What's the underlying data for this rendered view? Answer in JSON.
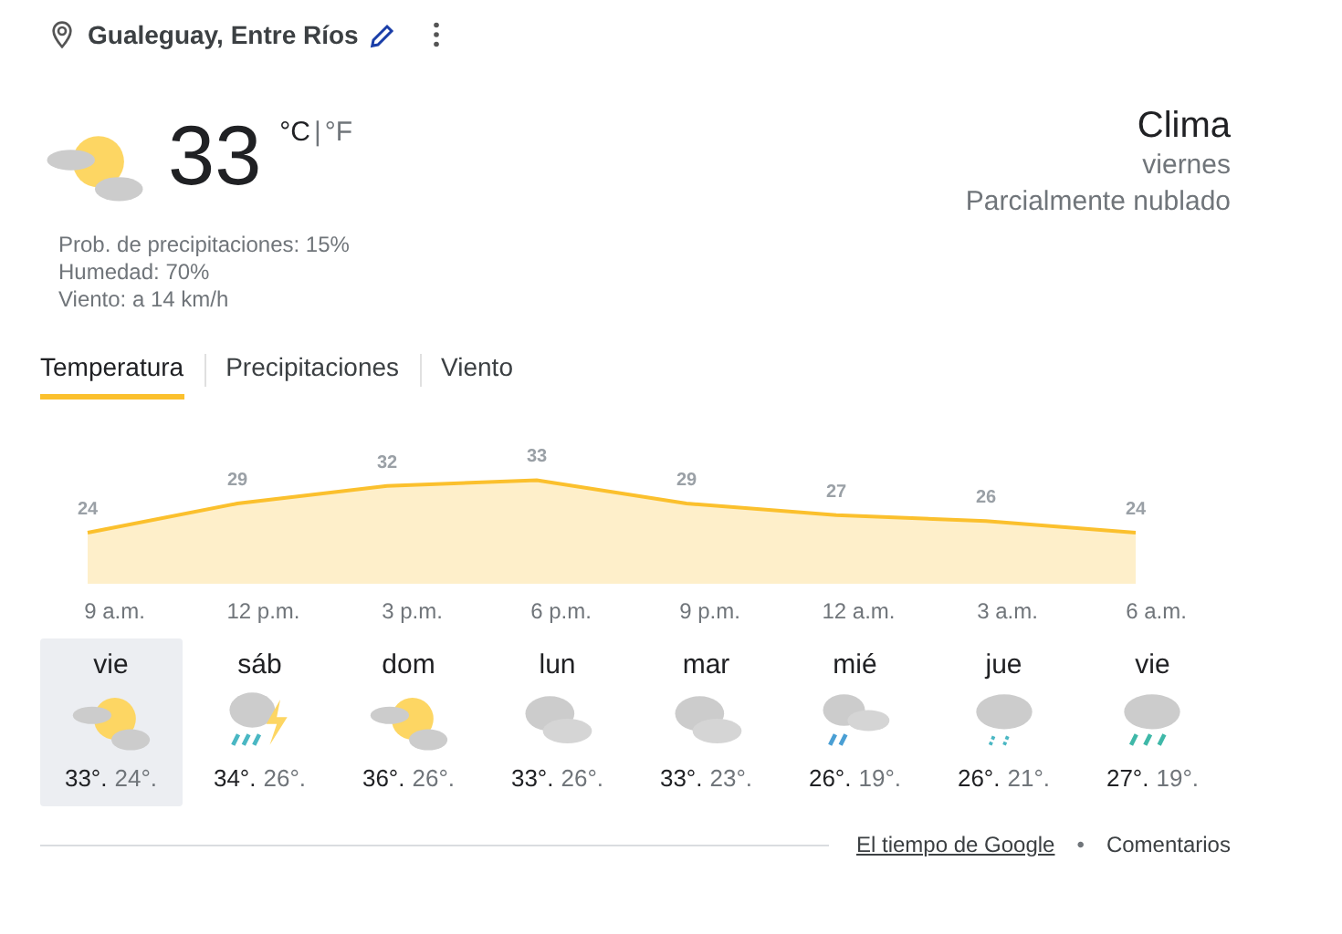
{
  "location": "Gualeguay, Entre Ríos",
  "current": {
    "kind": "partly_cloudy",
    "temperature": "33",
    "unit_c": "°C",
    "separator": "|",
    "unit_f": "°F",
    "unit_c_selected": true,
    "details": [
      "Prob. de precipitaciones: 15%",
      "Humedad: 70%",
      "Viento: a 14 km/h"
    ]
  },
  "summary": {
    "title": "Clima",
    "day": "viernes",
    "condition": "Parcialmente nublado"
  },
  "tabs": [
    {
      "label": "Temperatura",
      "selected": true
    },
    {
      "label": "Precipitaciones",
      "selected": false
    },
    {
      "label": "Viento",
      "selected": false
    }
  ],
  "chart_data": {
    "type": "area",
    "categories": [
      "9 a.m.",
      "12 p.m.",
      "3 p.m.",
      "6 p.m.",
      "9 p.m.",
      "12 a.m.",
      "3 a.m.",
      "6 a.m."
    ],
    "series": [
      {
        "color": "#fbc02d",
        "values": [
          24,
          29,
          32,
          33,
          29,
          27,
          26,
          24
        ]
      }
    ],
    "data_labels": true
  },
  "days": [
    {
      "name": "vie",
      "kind": "partly_cloudy",
      "high": "33°.",
      "low": "24°.",
      "selected": true
    },
    {
      "name": "sáb",
      "kind": "thunder_rain",
      "high": "34°.",
      "low": "26°.",
      "selected": false
    },
    {
      "name": "dom",
      "kind": "partly_cloudy",
      "high": "36°.",
      "low": "26°.",
      "selected": false
    },
    {
      "name": "lun",
      "kind": "cloudy",
      "high": "33°.",
      "low": "26°.",
      "selected": false
    },
    {
      "name": "mar",
      "kind": "cloudy",
      "high": "33°.",
      "low": "23°.",
      "selected": false
    },
    {
      "name": "mié",
      "kind": "cloudy_rain",
      "high": "26°.",
      "low": "19°.",
      "selected": false
    },
    {
      "name": "jue",
      "kind": "light_rain",
      "high": "26°.",
      "low": "21°.",
      "selected": false
    },
    {
      "name": "vie",
      "kind": "rain",
      "high": "27°.",
      "low": "19°.",
      "selected": false
    }
  ],
  "footer": {
    "source": "El tiempo de Google",
    "separator": "•",
    "feedback": "Comentarios"
  }
}
